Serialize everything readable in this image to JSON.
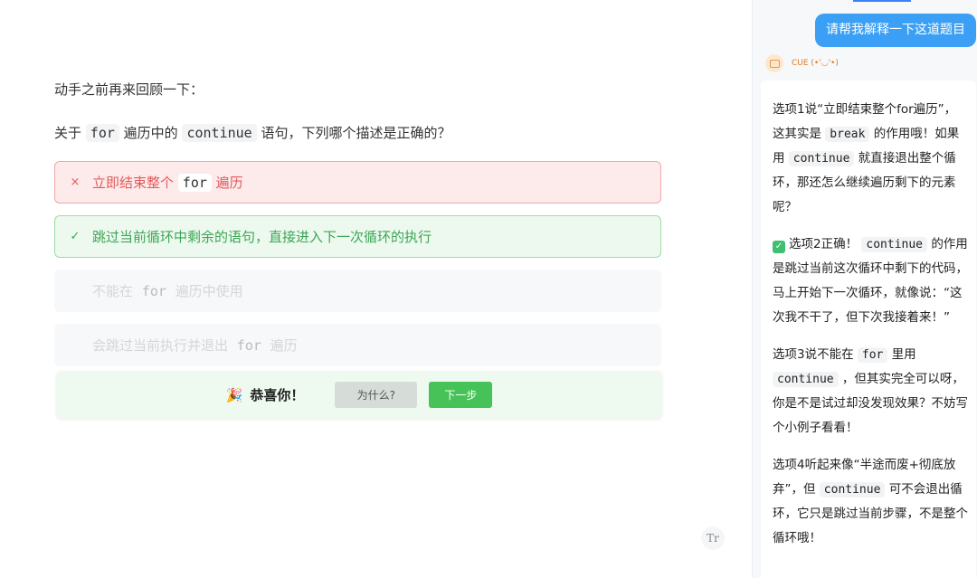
{
  "lesson": {
    "intro": "动手之前再来回顾一下：",
    "question": {
      "prefix": "关于",
      "code1": "for",
      "middle": "遍历中的",
      "code2": "continue",
      "suffix": "语句，下列哪个描述是正确的？"
    },
    "options": [
      {
        "state": "wrong",
        "mark": "×",
        "pre": "立即结束整个",
        "code": "for",
        "post": "遍历"
      },
      {
        "state": "correct",
        "mark": "✓",
        "text": "跳过当前循环中剩余的语句，直接进入下一次循环的执行"
      },
      {
        "state": "dim",
        "pre": "不能在",
        "code": "for",
        "post": "遍历中使用"
      },
      {
        "state": "dim",
        "pre": "会跳过当前执行并退出",
        "code": "for",
        "post": "遍历"
      }
    ],
    "congrats": {
      "emoji": "🎉",
      "text": "恭喜你！",
      "why_label": "为什么?",
      "next_label": "下一步"
    },
    "font_size_icon": "Tr"
  },
  "chat": {
    "user_message": "请帮我解释一下这道题目",
    "bot_name": "CUE (•'◡'•)",
    "reply": {
      "p1": {
        "a": "选项1说“立即结束整个for遍历”，这其实是",
        "code": "break",
        "b": "的作用哦！如果用",
        "code2": "continue",
        "c": "就直接退出整个循环，那还怎么继续遍历剩下的元素呢？"
      },
      "p2": {
        "check": "✓",
        "a": "选项2正确！",
        "code": "continue",
        "b": "的作用是跳过当前这次循环中剩下的代码，马上开始下一次循环，就像说：“这次我不干了，但下次我接着来！”"
      },
      "p3": {
        "a": "选项3说不能在",
        "code": "for",
        "b": "里用",
        "code2": "continue",
        "c": "，但其实完全可以呀，你是不是试过却没发现效果？不妨写个小例子看看！"
      },
      "p4": {
        "a": "选项4听起来像“半途而废+彻底放弃”，但",
        "code": "continue",
        "b": "可不会退出循环，它只是跳过当前步骤，不是整个循环哦！"
      }
    }
  },
  "colors": {
    "wrong_bg": "#fdeaea",
    "wrong_text": "#e25b5b",
    "correct_bg": "#edf9ee",
    "correct_text": "#3aa655",
    "next_button": "#46c258",
    "user_bubble": "#3ba0f5",
    "bot_accent": "#e07a1f"
  }
}
